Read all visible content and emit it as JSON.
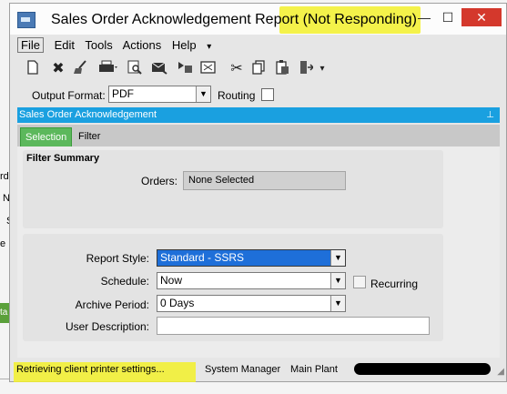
{
  "window": {
    "title": "Sales Order Acknowledgement Report (Not Responding)",
    "minimize": "—",
    "maximize": "☐",
    "close": "✕"
  },
  "menu": {
    "items": [
      "File",
      "Edit",
      "Tools",
      "Actions",
      "Help"
    ],
    "overflow": "▾"
  },
  "toolbar": {
    "icons": [
      "new-document-icon",
      "delete-icon",
      "clear-icon",
      "print-icon",
      "print-preview-icon",
      "email-icon",
      "send-icon",
      "schedule-icon",
      "cut-icon",
      "copy-icon",
      "paste-icon",
      "exit-icon"
    ],
    "overflow": "▾"
  },
  "output": {
    "label": "Output Format:",
    "value": "PDF",
    "routing_label": "Routing"
  },
  "panel": {
    "title": "Sales Order Acknowledgement",
    "pin": "⊥"
  },
  "tabs": {
    "selection": "Selection",
    "filter": "Filter"
  },
  "filter_summary": {
    "heading": "Filter Summary",
    "orders_label": "Orders:",
    "orders_value": "None Selected"
  },
  "form": {
    "report_style_label": "Report Style:",
    "report_style_value": "Standard - SSRS",
    "schedule_label": "Schedule:",
    "schedule_value": "Now",
    "recurring_label": "Recurring",
    "archive_label": "Archive Period:",
    "archive_value": "0 Days",
    "user_desc_label": "User Description:",
    "user_desc_value": ""
  },
  "status": {
    "message": "Retrieving client printer settings...",
    "user": "System Manager",
    "plant": "Main Plant"
  },
  "background": {
    "fragments": [
      "rd",
      "N",
      "S",
      "e B",
      "ta"
    ]
  },
  "colors": {
    "panel_header": "#1aa0e0",
    "active_tab": "#5cb85c",
    "highlight": "#f2f02a",
    "close_button": "#d4382c",
    "report_style_selected": "#1e6fd9"
  }
}
